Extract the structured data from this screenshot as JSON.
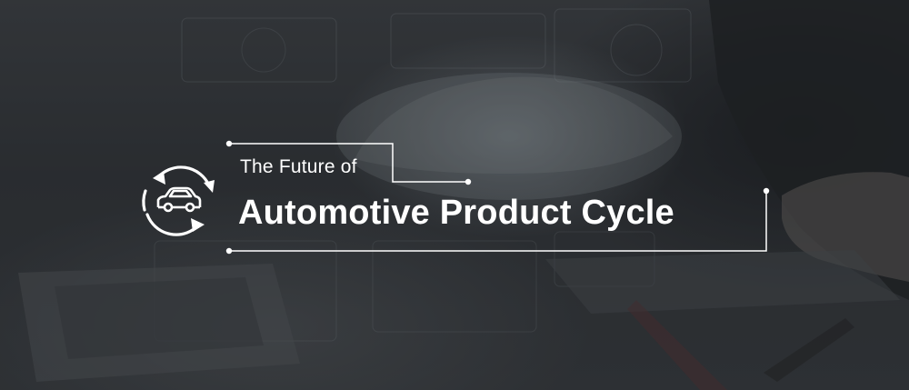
{
  "banner": {
    "line1": "The Future of",
    "line2": "Automotive Product Cycle"
  },
  "colors": {
    "text": "#ffffff",
    "frame": "#ffffff",
    "background": "#2f3236"
  },
  "icons": {
    "cycle": "car-cycle-icon"
  }
}
